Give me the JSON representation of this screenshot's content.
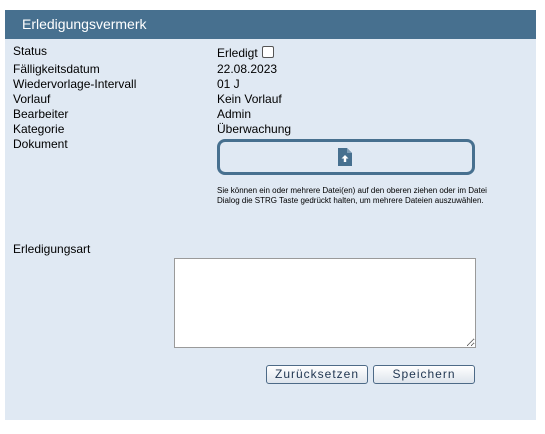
{
  "panel": {
    "title": "Erledigungsvermerk"
  },
  "fields": {
    "status_label": "Status",
    "status_value": "Erledigt",
    "status_checked": false,
    "due_label": "Fälligkeitsdatum",
    "due_value": "22.08.2023",
    "interval_label": "Wiedervorlage-Intervall",
    "interval_value": "01 J",
    "predecessor_label": "Vorlauf",
    "predecessor_value": "Kein Vorlauf",
    "editor_label": "Bearbeiter",
    "editor_value": "Admin",
    "category_label": "Kategorie",
    "category_value": "Überwachung",
    "document_label": "Dokument"
  },
  "upload": {
    "icon": "file-upload-icon",
    "hint": "Sie können ein oder mehrere Datei(en) auf den oberen ziehen oder im Datei Dialog die STRG Taste gedrückt halten, um mehrere Dateien auszuwählen."
  },
  "completion": {
    "label": "Erledigungsart",
    "value": ""
  },
  "buttons": {
    "reset": "Zurücksetzen",
    "save": "Speichern"
  },
  "colors": {
    "header": "#47708f",
    "panel": "#e0e9f3",
    "dropzone_border": "#47708f"
  }
}
